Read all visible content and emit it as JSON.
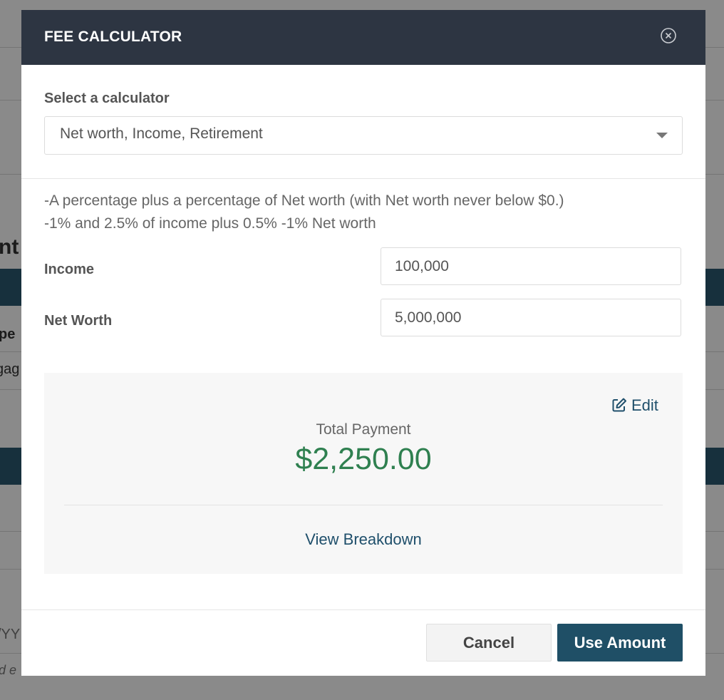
{
  "background": {
    "heading_fragment": "nt",
    "label_fragment_1": "pe",
    "label_fragment_2": "gag",
    "date_fragment": "/YY",
    "note_fragment": "d e"
  },
  "modal": {
    "title": "FEE CALCULATOR",
    "close_icon": "close-circle-icon",
    "select_label": "Select a calculator",
    "selected_calculator": "Net worth, Income, Retirement",
    "description_lines": [
      "-A percentage plus a percentage of Net worth (with Net worth never below $0.)",
      "-1% and 2.5% of income plus 0.5% -1% Net worth"
    ],
    "fields": {
      "income": {
        "label": "Income",
        "value": "100,000"
      },
      "net_worth": {
        "label": "Net Worth",
        "value": "5,000,000"
      }
    },
    "result": {
      "edit_label": "Edit",
      "edit_icon": "edit-icon",
      "total_label": "Total Payment",
      "total_value": "$2,250.00",
      "breakdown_label": "View Breakdown"
    },
    "buttons": {
      "cancel": "Cancel",
      "use_amount": "Use Amount"
    }
  },
  "colors": {
    "header_bg": "#2d3542",
    "accent": "#1f4f66",
    "total_green": "#2f8050"
  }
}
